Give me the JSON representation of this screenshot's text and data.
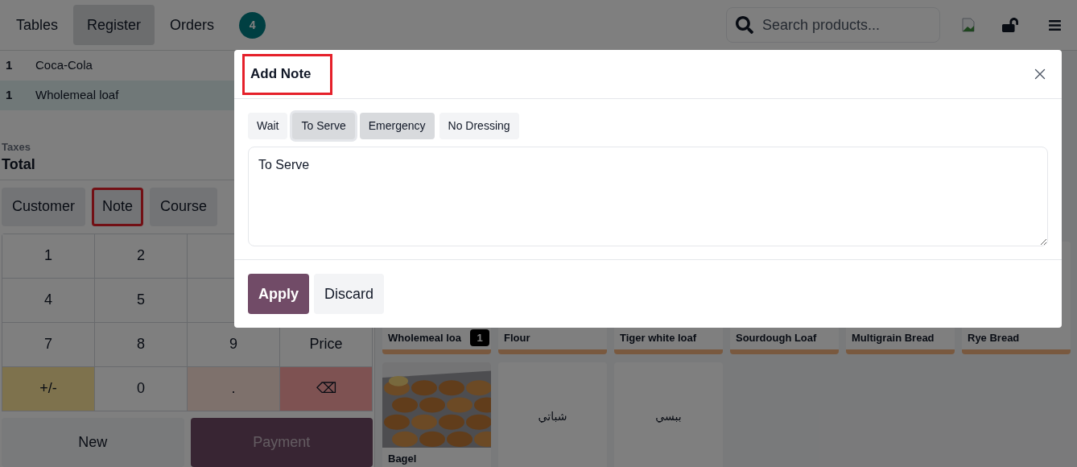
{
  "nav": {
    "tabs": [
      {
        "label": "Tables",
        "selected": false
      },
      {
        "label": "Register",
        "selected": true
      },
      {
        "label": "Orders",
        "selected": false
      }
    ],
    "orders_badge": "4",
    "search": {
      "placeholder": "Search products..."
    }
  },
  "order_lines": [
    {
      "qty": "1",
      "name": "Coca-Cola",
      "selected": false
    },
    {
      "qty": "1",
      "name": "Wholemeal loaf",
      "selected": true
    }
  ],
  "totals": {
    "taxes_label": "Taxes",
    "total_label": "Total"
  },
  "actions": [
    {
      "label": "Customer",
      "highlighted": false
    },
    {
      "label": "Note",
      "highlighted": true
    },
    {
      "label": "Course",
      "highlighted": false
    }
  ],
  "numpad": [
    [
      {
        "label": "1",
        "kind": "digit"
      },
      {
        "label": "2",
        "kind": "digit"
      }
    ],
    [
      {
        "label": "4",
        "kind": "digit"
      },
      {
        "label": "5",
        "kind": "digit"
      }
    ],
    [
      {
        "label": "7",
        "kind": "digit"
      },
      {
        "label": "8",
        "kind": "digit"
      },
      {
        "label": "9",
        "kind": "digit"
      },
      {
        "label": "Price",
        "kind": "digit"
      }
    ],
    [
      {
        "label": "+/-",
        "kind": "sign"
      },
      {
        "label": "0",
        "kind": "digit"
      },
      {
        "label": ".",
        "kind": "decimal"
      },
      {
        "label": "⌫",
        "kind": "backspace"
      }
    ]
  ],
  "bottom_buttons": [
    {
      "label": "New",
      "kind": "plain"
    },
    {
      "label": "Payment",
      "kind": "primary"
    }
  ],
  "products": [
    [
      {
        "name": "Wholemeal loa",
        "kind": "plain",
        "count": "1"
      },
      {
        "name": "Flour",
        "kind": "plain"
      },
      {
        "name": "Tiger white loaf",
        "kind": "plain"
      },
      {
        "name": "Sourdough Loaf",
        "kind": "plain"
      },
      {
        "name": "Multigrain Bread",
        "kind": "plain"
      },
      {
        "name": "Rye Bread",
        "kind": "plain"
      }
    ],
    [
      {
        "name": "Bagel",
        "kind": "picture"
      },
      {
        "name": "شباتي",
        "kind": "text"
      },
      {
        "name": "ببسي",
        "kind": "text"
      }
    ]
  ],
  "dialog": {
    "title": "Add Note",
    "title_highlighted": true,
    "chips": [
      {
        "label": "Wait",
        "selected": false,
        "focused": false
      },
      {
        "label": "To Serve",
        "selected": true,
        "focused": true
      },
      {
        "label": "Emergency",
        "selected": true,
        "focused": false
      },
      {
        "label": "No Dressing",
        "selected": false,
        "focused": false
      }
    ],
    "note": "To Serve",
    "buttons": [
      {
        "label": "Apply",
        "kind": "primary"
      },
      {
        "label": "Discard",
        "kind": "secondary"
      }
    ]
  }
}
